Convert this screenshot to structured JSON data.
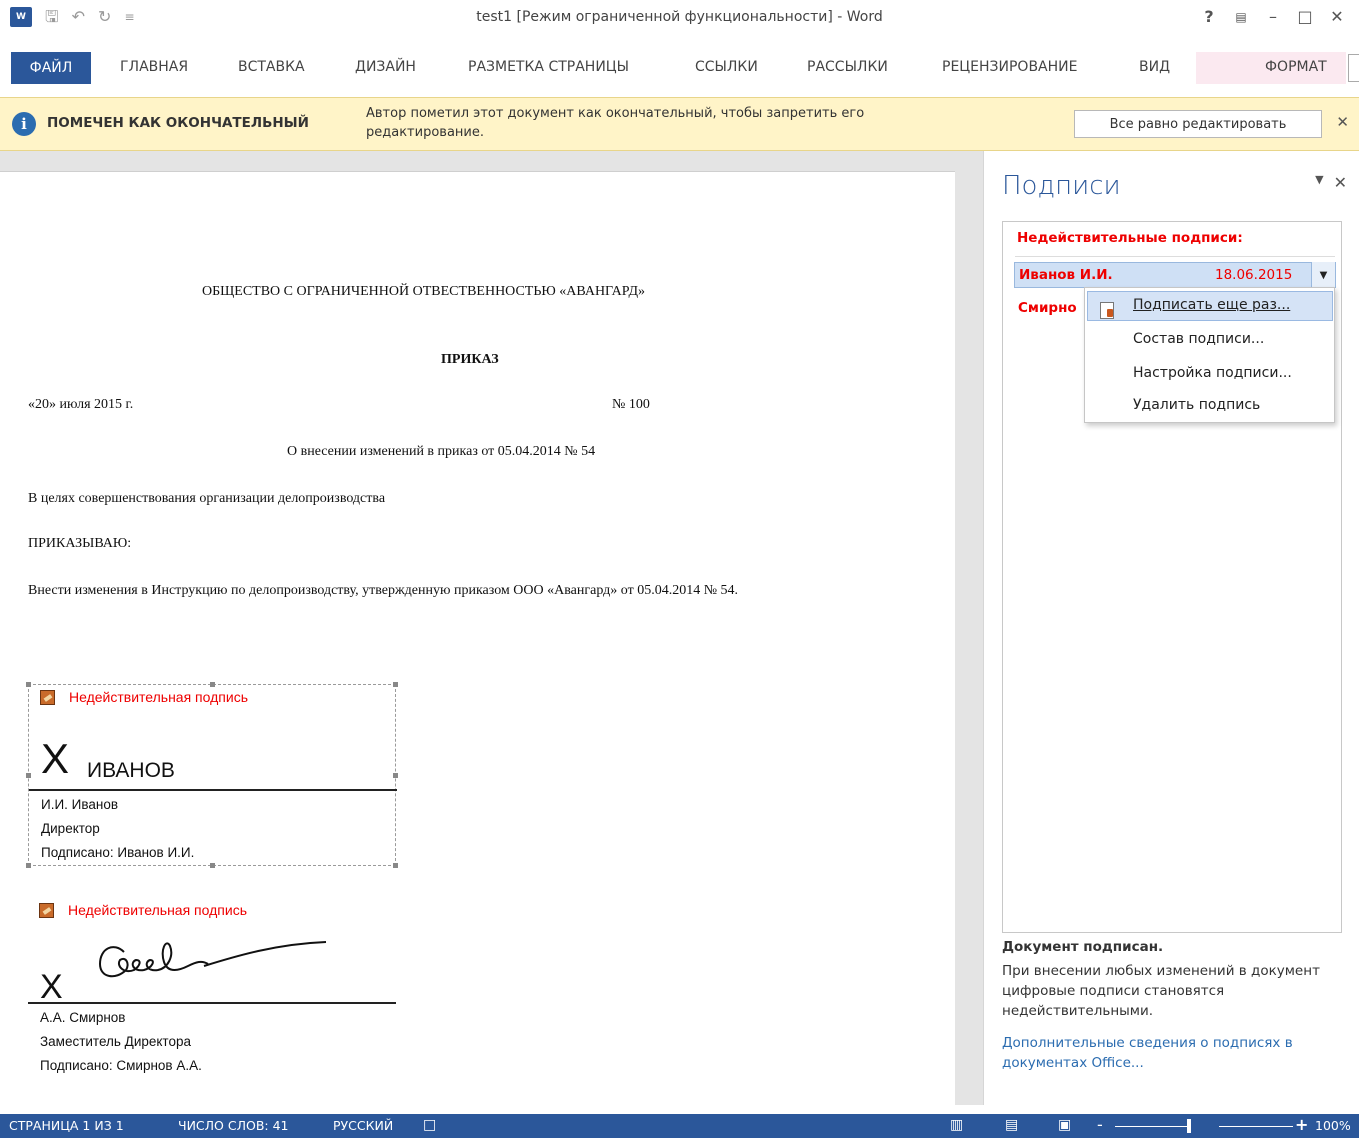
{
  "window": {
    "title": "test1 [Режим ограниченной функциональности] - Word",
    "app_logo": "W",
    "help": "?",
    "controls": [
      "restore-ribbon-icon",
      "minimize-icon",
      "maximize-icon",
      "close-icon"
    ]
  },
  "qat": {
    "save_icon": "save-icon",
    "undo_icon": "undo-icon",
    "redo_icon": "redo-icon",
    "customize_icon": "customize-icon"
  },
  "ribbon": {
    "tabs": [
      "ФАЙЛ",
      "ГЛАВНАЯ",
      "ВСТАВКА",
      "ДИЗАЙН",
      "РАЗМЕТКА СТРАНИЦЫ",
      "ССЫЛКИ",
      "РАССЫЛКИ",
      "РЕЦЕНЗИРОВАНИЕ",
      "ВИД",
      "ФОРМАТ"
    ],
    "active_color": "#2b579a"
  },
  "message_bar": {
    "title": "ПОМЕЧЕН КАК ОКОНЧАТЕЛЬНЫЙ",
    "text": "Автор пометил этот документ как окончательный, чтобы запретить его редактирование.",
    "button": "Все равно редактировать",
    "background": "#fff4c8"
  },
  "document": {
    "org": "ОБЩЕСТВО С ОГРАНИЧЕННОЙ ОТВЕСТВЕННОСТЬЮ «АВАНГАРД»",
    "heading": "ПРИКАЗ",
    "date": "«20» июля 2015 г.",
    "number": "№ 100",
    "subject": "О внесении изменений в приказ от 05.04.2014 № 54",
    "para1": "В целях совершенствования организации делопроизводства",
    "para2": "ПРИКАЗЫВАЮ:",
    "para3": "Внести изменения в Инструкцию по делопроизводству, утвержденную приказом ООО «Авангард» от 05.04.2014 № 54.",
    "signatures": [
      {
        "status": "Недействительная подпись",
        "x": "X",
        "signed_text": "ИВАНОВ",
        "name": "И.И. Иванов",
        "title": "Директор",
        "signed_by": "Подписано: Иванов И.И."
      },
      {
        "status": "Недействительная подпись",
        "x": "X",
        "name": "А.А. Смирнов",
        "title": "Заместитель Директора",
        "signed_by": "Подписано: Смирнов А.А."
      }
    ]
  },
  "pane": {
    "title": "Подписи",
    "invalid_heading": "Недействительные подписи:",
    "rows": [
      {
        "name": "Иванов И.И.",
        "date": "18.06.2015"
      },
      {
        "name": "Смирно"
      }
    ],
    "footer_bold": "Документ подписан.",
    "footer_text": "При внесении любых изменений в документ цифровые подписи становятся недействительными.",
    "footer_link": "Дополнительные сведения о подписях в документах Office..."
  },
  "context_menu": {
    "items": [
      "Подписать еще раз...",
      "Состав подписи...",
      "Настройка подписи...",
      "Удалить подпись"
    ]
  },
  "status_bar": {
    "page": "СТРАНИЦА 1 ИЗ 1",
    "words": "ЧИСЛО СЛОВ: 41",
    "language": "РУССКИЙ",
    "zoom_minus": "-",
    "zoom_plus": "+",
    "zoom": "100%",
    "background": "#2b579a"
  },
  "colors": {
    "invalid_red": "#e00000",
    "accent_blue": "#2b579a",
    "selection": "#cfe0f5"
  }
}
